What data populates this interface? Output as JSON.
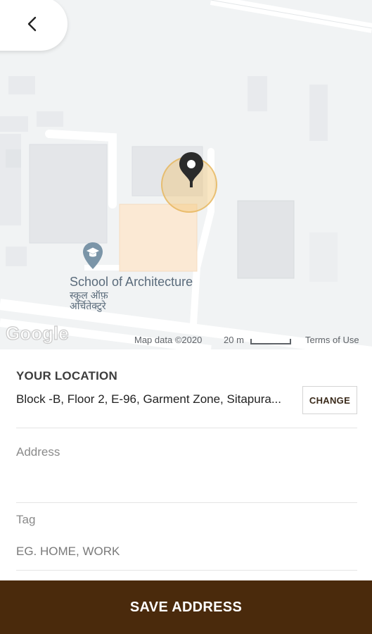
{
  "map": {
    "poi_name": "School of Architecture",
    "poi_name_local": "स्कूल ऑफ़ अर्चितेक्टुरे",
    "google_logo": "Google",
    "map_data": "Map data ©2020",
    "scale": "20 m",
    "terms": "Terms of Use",
    "pin_color": "#2b2b2b",
    "accuracy_color": "#f0c470"
  },
  "back_button": {
    "icon": "chevron-left-icon"
  },
  "location": {
    "heading": "YOUR LOCATION",
    "value": "Block -B, Floor 2, E-96, Garment Zone, Sitapura...",
    "change_label": "CHANGE"
  },
  "form": {
    "address_label": "Address",
    "address_value": "",
    "tag_label": "Tag",
    "tag_placeholder": "EG. HOME, WORK"
  },
  "footer": {
    "save_label": "SAVE ADDRESS",
    "save_color": "#4a2a0c"
  }
}
